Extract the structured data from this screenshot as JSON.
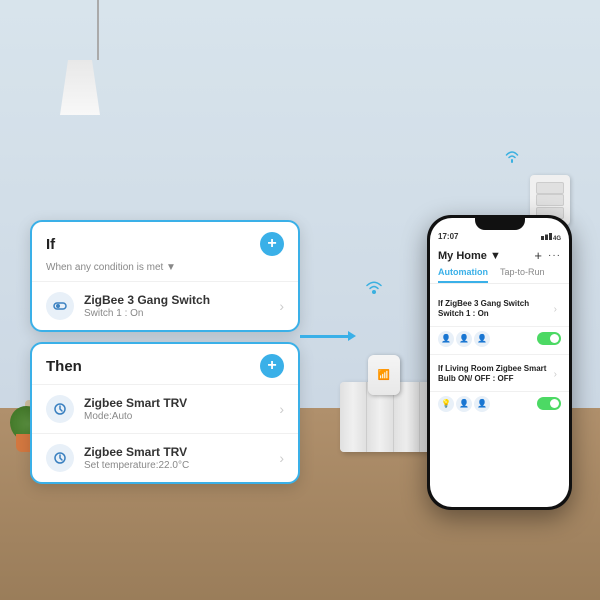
{
  "scene": {
    "bg_wall_color": "#d8e4ec",
    "bg_floor_color": "#b0906c"
  },
  "if_card": {
    "title": "If",
    "subtitle": "When any condition is met ▼",
    "add_label": "+",
    "item": {
      "name": "ZigBee 3 Gang Switch",
      "sub": "Switch 1 : On"
    }
  },
  "then_card": {
    "title": "Then",
    "add_label": "+",
    "items": [
      {
        "name": "Zigbee Smart TRV",
        "sub": "Mode:Auto"
      },
      {
        "name": "Zigbee Smart TRV",
        "sub": "Set temperature:22.0°C"
      }
    ]
  },
  "phone": {
    "time": "17:07",
    "signal": "4G",
    "header_title": "My Home ▼",
    "header_plus": "+",
    "header_more": "···",
    "tab_automation": "Automation",
    "tab_taptorun": "Tap-to-Run",
    "rules": [
      {
        "text": "If ZigBee 3 Gang Switch Switch 1 : On",
        "has_toggle": true
      },
      {
        "text": "If Living Room Zigbee Smart Bulb ON/ OFF : OFF",
        "has_toggle": true
      }
    ]
  }
}
